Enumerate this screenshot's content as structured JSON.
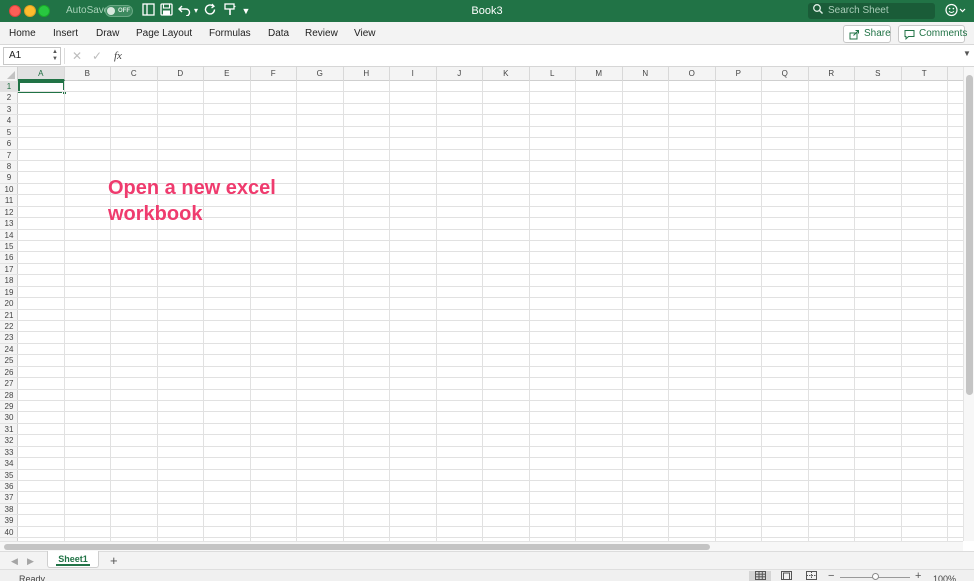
{
  "window": {
    "title": "Book3",
    "autosave_label": "AutoSave",
    "autosave_state": "OFF",
    "search_placeholder": "Search Sheet"
  },
  "ribbon": {
    "tabs": [
      "Home",
      "Insert",
      "Draw",
      "Page Layout",
      "Formulas",
      "Data",
      "Review",
      "View"
    ],
    "share_label": "Share",
    "comments_label": "Comments"
  },
  "formula_bar": {
    "name_box": "A1",
    "fx_label": "fx",
    "formula_value": ""
  },
  "grid": {
    "columns": [
      "A",
      "B",
      "C",
      "D",
      "E",
      "F",
      "G",
      "H",
      "I",
      "J",
      "K",
      "L",
      "M",
      "N",
      "O",
      "P",
      "Q",
      "R",
      "S",
      "T"
    ],
    "row_count": 40,
    "selected_cell": "A1",
    "selected_column": "A",
    "selected_row": "1"
  },
  "annotation": {
    "line1": "Open a new excel",
    "line2": "workbook",
    "color": "#ef3b6e"
  },
  "sheets": {
    "tabs": [
      "Sheet1"
    ],
    "active": "Sheet1",
    "add_label": "+"
  },
  "status": {
    "text": "Ready",
    "zoom": "100%"
  },
  "colors": {
    "accent": "#217346",
    "title_bar": "#217346"
  }
}
